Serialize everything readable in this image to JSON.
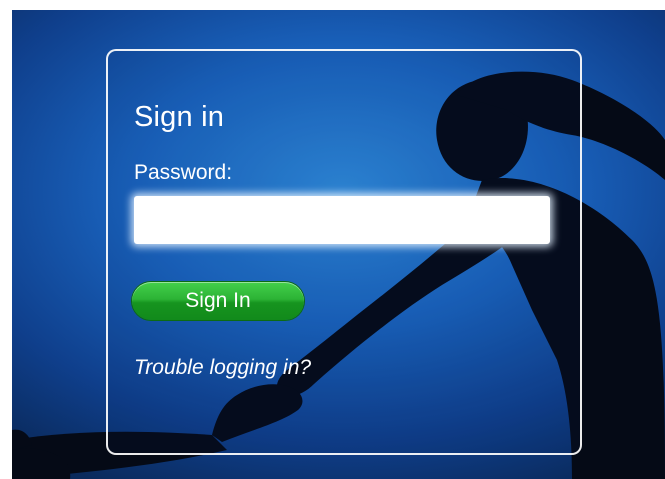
{
  "login": {
    "title": "Sign in",
    "password_label": "Password:",
    "password_value": "",
    "password_placeholder": "",
    "sign_in_button_label": "Sign In",
    "trouble_link": "Trouble logging in?"
  },
  "colors": {
    "background_blue": "#1a64bf",
    "button_green": "#2cb335",
    "text": "#ffffff"
  }
}
